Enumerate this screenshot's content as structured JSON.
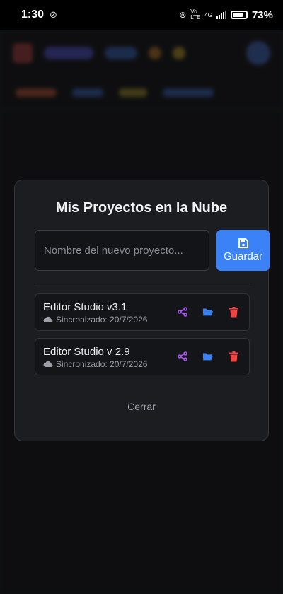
{
  "status_bar": {
    "time": "1:30",
    "network_volte": "Vo LTE",
    "network_type": "4G",
    "battery": "73%"
  },
  "modal": {
    "title": "Mis Proyectos en la Nube",
    "input_placeholder": "Nombre del nuevo proyecto...",
    "input_value": "",
    "save_label": "Guardar",
    "close_label": "Cerrar",
    "projects": [
      {
        "name": "Editor Studio v3.1",
        "sync": "Sincronizado: 20/7/2026"
      },
      {
        "name": "Editor Studio v 2.9",
        "sync": "Sincronizado: 20/7/2026"
      }
    ]
  },
  "colors": {
    "accent": "#3b82f6",
    "share": "#a855f7",
    "folder": "#3b82f6",
    "delete": "#ef4444"
  }
}
